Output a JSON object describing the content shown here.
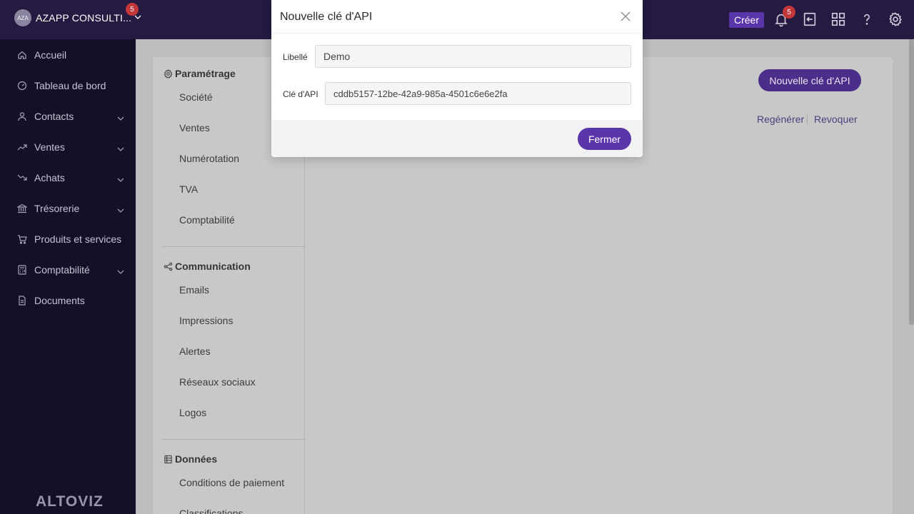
{
  "topbar": {
    "avatar_initials": "AZA",
    "company_name": "AZAPP CONSULTI...",
    "company_badge": "5",
    "create_label": "Créer",
    "notifications_badge": "5",
    "icons": [
      "bell-icon",
      "logout-icon",
      "apps-grid-icon",
      "help-icon",
      "settings-icon"
    ]
  },
  "sidebar": {
    "items": [
      {
        "label": "Accueil",
        "icon": "home-icon"
      },
      {
        "label": "Tableau de bord",
        "icon": "dashboard-icon"
      },
      {
        "label": "Contacts",
        "icon": "user-icon",
        "expandable": true
      },
      {
        "label": "Ventes",
        "icon": "trend-up-icon",
        "expandable": true
      },
      {
        "label": "Achats",
        "icon": "trend-down-icon",
        "expandable": true
      },
      {
        "label": "Trésorerie",
        "icon": "bank-icon",
        "expandable": true
      },
      {
        "label": "Produits et services",
        "icon": "cart-icon"
      },
      {
        "label": "Comptabilité",
        "icon": "calculator-icon",
        "expandable": true
      },
      {
        "label": "Documents",
        "icon": "document-icon"
      }
    ],
    "brand": "ALTOVIZ"
  },
  "settings_nav": {
    "sections": [
      {
        "title": "Paramétrage",
        "icon": "gear-icon",
        "items": [
          "Société",
          "Ventes",
          "Numérotation",
          "TVA",
          "Comptabilité"
        ]
      },
      {
        "title": "Communication",
        "icon": "share-icon",
        "items": [
          "Emails",
          "Impressions",
          "Alertes",
          "Réseaux sociaux",
          "Logos"
        ]
      },
      {
        "title": "Données",
        "icon": "database-icon",
        "items": [
          "Conditions de paiement",
          "Classifications"
        ]
      }
    ]
  },
  "main": {
    "new_key_button": "Nouvelle clé d'API",
    "regenerate_link": "Regénérer",
    "revoke_link": "Revoquer"
  },
  "modal": {
    "title": "Nouvelle clé d'API",
    "label_field_label": "Libellé",
    "label_field_value": "Demo",
    "api_key_label": "Clé d'API",
    "api_key_value": "cddb5157-12be-42a9-985a-4501c6e6e2fa",
    "close_button": "Fermer"
  },
  "colors": {
    "topbar_bg": "#251a42",
    "sidebar_bg": "#151029",
    "accent": "#5a35a9",
    "badge": "#c3363a"
  }
}
